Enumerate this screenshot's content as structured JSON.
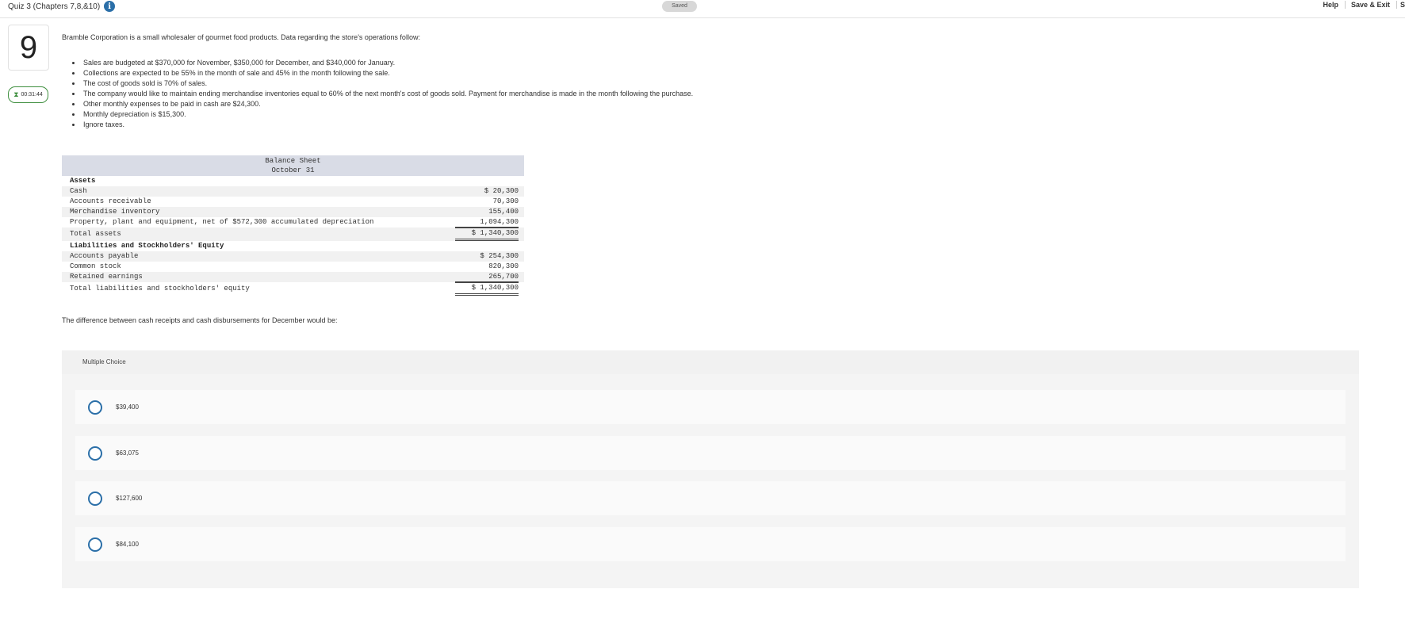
{
  "header": {
    "quiz_title": "Quiz 3 (Chapters 7,8,&10)",
    "info_icon": "info-icon",
    "saved_label": "Saved",
    "help_label": "Help",
    "save_exit_label": "Save & Exit",
    "submit_label": "S"
  },
  "question": {
    "number": "9",
    "timer": "00:31:44",
    "timer_icon": "hourglass-icon",
    "intro": "Bramble Corporation is a small wholesaler of gourmet food products. Data regarding the store's operations follow:",
    "bullets": [
      "Sales are budgeted at $370,000 for November, $350,000 for December, and $340,000 for January.",
      "Collections are expected to be 55% in the month of sale and 45% in the month following the sale.",
      "The cost of goods sold is 70% of sales.",
      "The company would like to maintain ending merchandise inventories equal to 60% of the next month's cost of goods sold. Payment for merchandise is made in the month following the purchase.",
      "Other monthly expenses to be paid in cash are $24,300.",
      "Monthly depreciation is $15,300.",
      "Ignore taxes."
    ],
    "prompt": "The difference between cash receipts and cash disbursements for December would be:"
  },
  "balance_sheet": {
    "title": "Balance Sheet",
    "date": "October 31",
    "assets_heading": "Assets",
    "assets": [
      {
        "label": "Cash",
        "amount": "$ 20,300"
      },
      {
        "label": "Accounts receivable",
        "amount": "70,300"
      },
      {
        "label": "Merchandise inventory",
        "amount": "155,400"
      },
      {
        "label": "Property, plant and equipment, net of $572,300 accumulated depreciation",
        "amount": "1,094,300"
      }
    ],
    "total_assets": {
      "label": "Total assets",
      "amount": "$ 1,340,300"
    },
    "liabilities_heading": "Liabilities and Stockholders' Equity",
    "liabilities": [
      {
        "label": "Accounts payable",
        "amount": "$ 254,300"
      },
      {
        "label": "Common stock",
        "amount": "820,300"
      },
      {
        "label": "Retained earnings",
        "amount": "265,700"
      }
    ],
    "total_liabilities": {
      "label": "Total liabilities and stockholders' equity",
      "amount": "$ 1,340,300"
    }
  },
  "multiple_choice": {
    "label": "Multiple Choice",
    "options": [
      "$39,400",
      "$63,075",
      "$127,600",
      "$84,100"
    ]
  },
  "colors": {
    "accent": "#2b6fa8",
    "timer_border": "#3f8f3f",
    "sheet_header_bg": "#d9dce6"
  }
}
